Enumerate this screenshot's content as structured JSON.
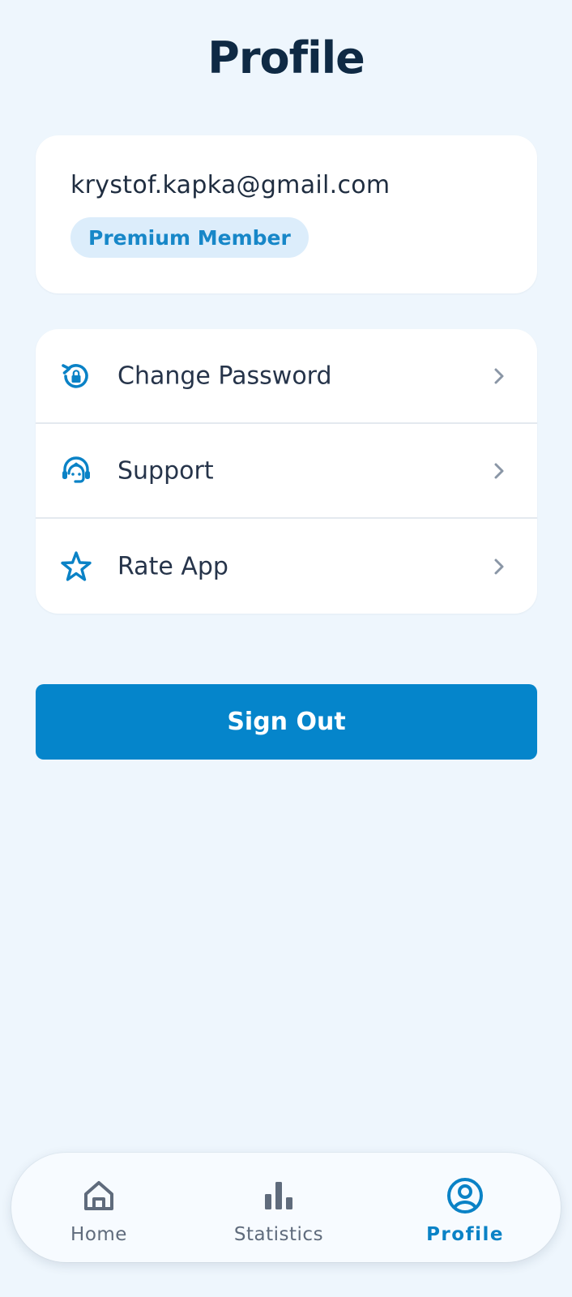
{
  "header": {
    "title": "Profile"
  },
  "account": {
    "email": "krystof.kapka@gmail.com",
    "badge": "Premium Member"
  },
  "menu": {
    "items": [
      {
        "label": "Change Password",
        "icon": "lock-reset-icon"
      },
      {
        "label": "Support",
        "icon": "headset-support-icon"
      },
      {
        "label": "Rate App",
        "icon": "star-icon"
      }
    ]
  },
  "actions": {
    "sign_out": "Sign Out"
  },
  "tabbar": {
    "tabs": [
      {
        "label": "Home",
        "icon": "home-icon",
        "active": false
      },
      {
        "label": "Statistics",
        "icon": "bar-chart-icon",
        "active": false
      },
      {
        "label": "Profile",
        "icon": "profile-icon",
        "active": true
      }
    ]
  },
  "colors": {
    "background": "#eef6fd",
    "accent": "#0585cb",
    "title": "#0f2a44",
    "badge_bg": "#dcedfb",
    "inactive_tab": "#5f6b7c"
  }
}
